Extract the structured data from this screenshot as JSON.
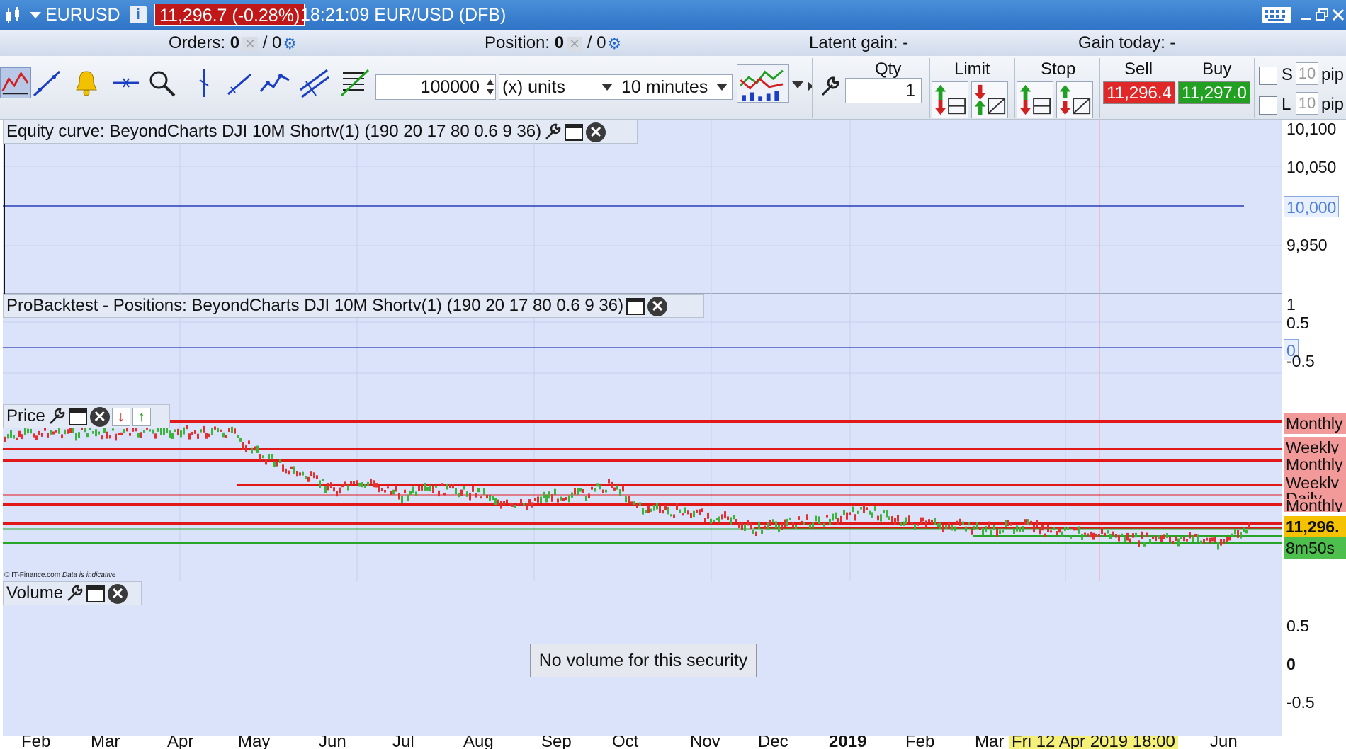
{
  "titlebar": {
    "symbol": "EURUSD",
    "price_change": "11,296.7 (-0.28%)",
    "time_and_name": "18:21:09 EUR/USD (DFB)",
    "info": "i"
  },
  "infobar": {
    "orders_label": "Orders: ",
    "orders_value": "0",
    "orders_sep": "/ 0",
    "position_label": "Position: ",
    "position_value": "0",
    "position_sep": "/ 0",
    "latent_gain": "Latent gain: -",
    "gain_today": "Gain today: -"
  },
  "toolbar": {
    "quantity_field": "100000",
    "units_select": "(x) units",
    "timeframe_select": "10 minutes",
    "qty_label": "Qty",
    "qty_value": "1",
    "limit_label": "Limit",
    "stop_label": "Stop",
    "sell_label": "Sell",
    "buy_label": "Buy",
    "sell_price": "11,296.4",
    "buy_price": "11,297.0",
    "s_label": "S",
    "l_label": "L",
    "pip_s_value": "10",
    "pip_l_value": "10",
    "pip_unit": "pip"
  },
  "panels": {
    "equity_title": "Equity curve: BeyondCharts DJI 10M Shortv(1) (190 20 17 80 0.6 9 36)",
    "positions_title": "ProBacktest - Positions: BeyondCharts DJI 10M Shortv(1) (190 20 17 80 0.6 9 36)",
    "price_title": "Price",
    "volume_title": "Volume",
    "no_volume": "No volume for this security",
    "copyright": "© IT-Finance.com",
    "indicative": "Data is indicative"
  },
  "equity_axis": [
    "10,100",
    "10,050",
    "10,000",
    "9,950"
  ],
  "positions_axis": [
    "1",
    "0.5",
    "0",
    "-0.5"
  ],
  "volume_axis": [
    "0.5",
    "0",
    "-0.5"
  ],
  "price_axis": {
    "levels": [
      "Monthly",
      "Weekly",
      "Monthly",
      "Weekly",
      "Daily",
      "Monthly"
    ],
    "current_price": "11,296.",
    "countdown": "8m50s"
  },
  "x_axis": [
    "Feb",
    "Mar",
    "Apr",
    "May",
    "Jun",
    "Jul",
    "Aug",
    "Sep",
    "Oct",
    "Nov",
    "Dec",
    "2019",
    "Feb",
    "Mar",
    "Apr",
    "Jun"
  ],
  "x_axis_highlight": "Fri 12 Apr 2019 18:00",
  "colors": {
    "title_bar": "#2f74c6",
    "panel_bg": "#dbe3fb",
    "support_red": "#e01818",
    "support_green": "#28a428",
    "sell": "#e02020",
    "buy": "#20a020",
    "price_badge": "#f2c200"
  }
}
